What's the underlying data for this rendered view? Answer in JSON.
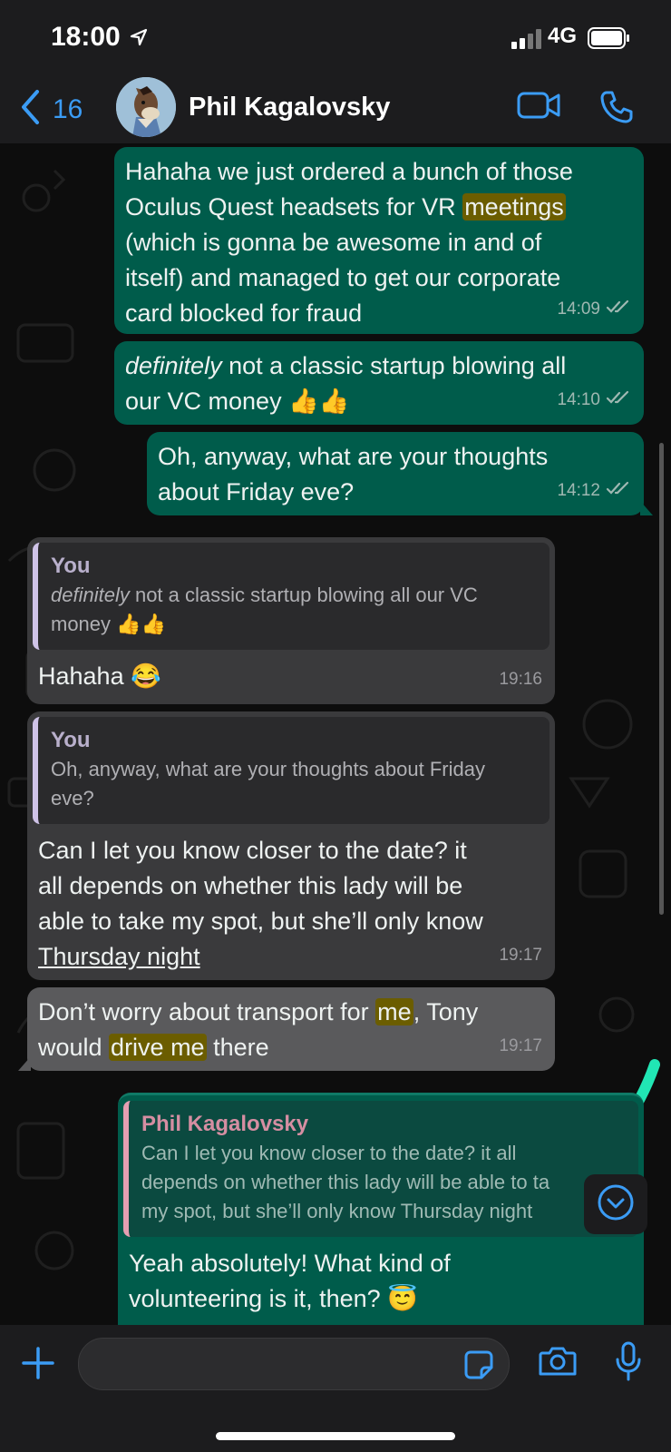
{
  "status_bar": {
    "time": "18:00",
    "network": "4G"
  },
  "header": {
    "back_count": "16",
    "contact_name": "Phil Kagalovsky"
  },
  "messages": {
    "m1": {
      "line1": "Hahaha we just ordered a bunch of those",
      "line2a": "Oculus Quest headsets for VR ",
      "line2b": "meetings",
      "line3": "(which is gonna be awesome in and of",
      "line4": "itself) and managed to get our corporate",
      "line5": "card blocked for fraud",
      "time": "14:09"
    },
    "m2": {
      "em": "definitely",
      "line1": " not a classic startup blowing all",
      "line2": "our VC money 👍👍",
      "time": "14:10"
    },
    "m3": {
      "line1": "Oh, anyway, what are your thoughts",
      "line2": "about Friday eve?",
      "time": "14:12"
    },
    "m4": {
      "quote_name": "You",
      "quote_em": "definitely",
      "quote_rest1": " not a classic startup blowing all our VC",
      "quote_rest2": "money 👍👍",
      "text": "Hahaha 😂",
      "time": "19:16"
    },
    "m5": {
      "quote_name": "You",
      "quote_line1": "Oh, anyway, what are your thoughts about Friday",
      "quote_line2": "eve?",
      "line1": "Can I let you know closer to the date? it",
      "line2": "all depends on whether this lady will be",
      "line3": "able to take my spot, but she’ll only know",
      "line4": "Thursday night",
      "time": "19:17"
    },
    "m6": {
      "a": "Don’t worry about transport for ",
      "b": "me",
      "c": ", Tony",
      "d": "would ",
      "e": "drive me",
      "f": " there",
      "time": "19:17"
    },
    "m7": {
      "quote_name": "Phil Kagalovsky",
      "quote_line1": "Can I let you know closer to the date? it all",
      "quote_line2": "depends on whether this lady will be able to ta",
      "quote_line3": "my spot, but she’ll only know Thursday night",
      "line1": "Yeah absolutely! What kind of",
      "line2": "volunteering is it, then? 😇"
    }
  },
  "input": {
    "placeholder": ""
  },
  "colors": {
    "accent": "#3b9cf5",
    "outgoing_bubble": "#005c4b",
    "incoming_bubble": "#3a3a3c",
    "highlight": "#6b5d00",
    "annotation_arrow": "#21e6b4"
  },
  "icons": [
    "location-arrow-icon",
    "signal-icon",
    "battery-icon",
    "back-chevron-icon",
    "video-call-icon",
    "phone-icon",
    "double-check-icon",
    "scroll-down-icon",
    "plus-icon",
    "sticker-icon",
    "camera-icon",
    "microphone-icon"
  ]
}
